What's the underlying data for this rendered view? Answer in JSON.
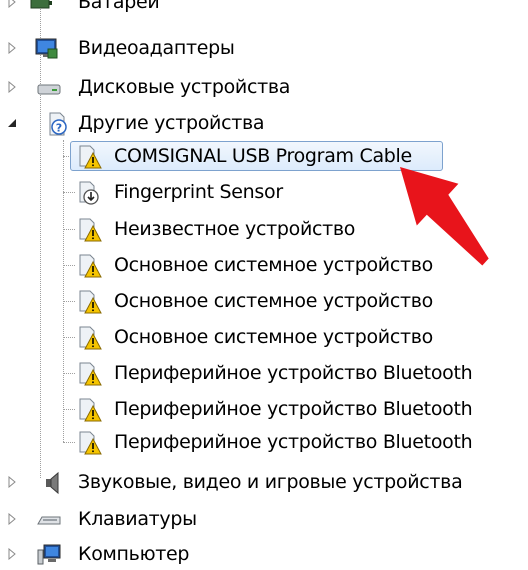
{
  "tree": {
    "top_categories": [
      {
        "label": "Батареи",
        "icon": "battery-icon",
        "expanded": false
      },
      {
        "label": "Видеоадаптеры",
        "icon": "monitor-icon",
        "expanded": false
      },
      {
        "label": "Дисковые устройства",
        "icon": "disk-drive-icon",
        "expanded": false
      },
      {
        "label": "Другие устройства",
        "icon": "unknown-device-icon",
        "expanded": true
      }
    ],
    "other_devices": [
      {
        "label": "COMSIGNAL USB Program Cable",
        "icon": "warning-device-icon",
        "selected": true
      },
      {
        "label": "Fingerprint Sensor",
        "icon": "download-device-icon",
        "selected": false
      },
      {
        "label": "Неизвестное устройство",
        "icon": "warning-device-icon",
        "selected": false
      },
      {
        "label": "Основное системное устройство",
        "icon": "warning-device-icon",
        "selected": false
      },
      {
        "label": "Основное системное устройство",
        "icon": "warning-device-icon",
        "selected": false
      },
      {
        "label": "Основное системное устройство",
        "icon": "warning-device-icon",
        "selected": false
      },
      {
        "label": "Периферийное устройство Bluetooth",
        "icon": "warning-device-icon",
        "selected": false
      },
      {
        "label": "Периферийное устройство Bluetooth",
        "icon": "warning-device-icon",
        "selected": false
      },
      {
        "label": "Периферийное устройство Bluetooth",
        "icon": "warning-device-icon",
        "selected": false
      }
    ],
    "bottom_categories": [
      {
        "label": "Звуковые, видео и игровые устройства",
        "icon": "speaker-icon",
        "expanded": false
      },
      {
        "label": "Клавиатуры",
        "icon": "keyboard-icon",
        "expanded": false
      },
      {
        "label": "Компьютер",
        "icon": "computer-icon",
        "expanded": false
      }
    ]
  },
  "annotation": {
    "icon": "red-arrow-icon",
    "color": "#e8141b"
  },
  "colors": {
    "selection_border": "#7da2ce",
    "warning_yellow": "#f5c400"
  }
}
